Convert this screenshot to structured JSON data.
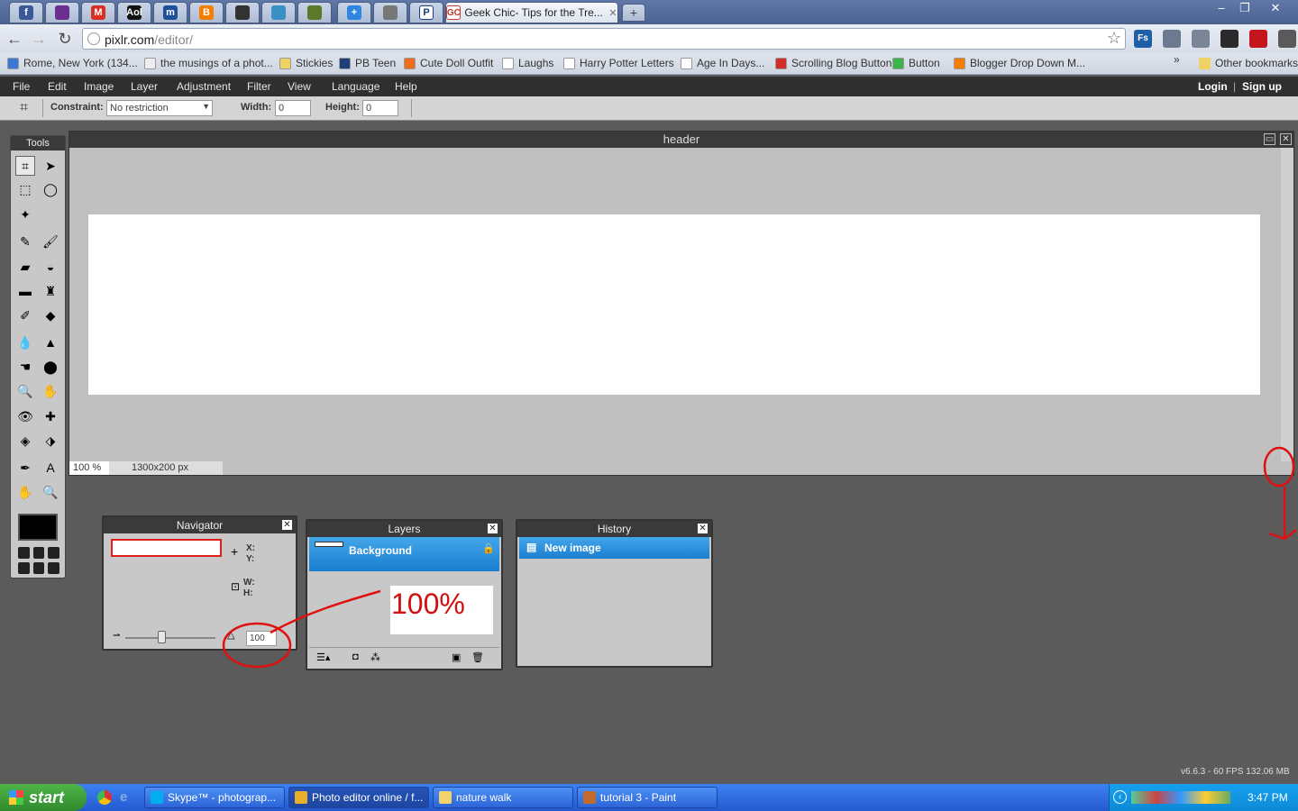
{
  "browser": {
    "tabs": [
      {
        "icon": "facebook-icon",
        "letter": "f",
        "color": "#3b5998"
      },
      {
        "icon": "yahoo-mail-icon",
        "letter": "",
        "color": "#6b2f91"
      },
      {
        "icon": "gmail-icon",
        "letter": "M",
        "color": "#d93025"
      },
      {
        "icon": "aol-icon",
        "letter": "Aol",
        "color": "#111111"
      },
      {
        "icon": "m-icon",
        "letter": "m",
        "color": "#1e4f9a"
      },
      {
        "icon": "blogger-icon",
        "letter": "B",
        "color": "#f57d00"
      },
      {
        "icon": "camera-icon",
        "letter": "",
        "color": "#333333"
      },
      {
        "icon": "photo-icon",
        "letter": "",
        "color": "#3a8fc4"
      },
      {
        "icon": "pixlr-icon",
        "letter": "",
        "color": "#5a7a2a"
      },
      {
        "icon": "plus-icon",
        "letter": "+",
        "color": "#2f86e0"
      },
      {
        "icon": "loading-icon",
        "letter": "",
        "color": "#777777"
      },
      {
        "icon": "p-icon",
        "letter": "P",
        "color": "#ffffff"
      }
    ],
    "active_tab_title": "Geek Chic- Tips for the Tre...",
    "url_host": "pixlr.com",
    "url_path": "/editor/",
    "extensions": [
      {
        "icon": "fs-icon",
        "label": "Fs",
        "color": "#1f5fa8"
      },
      {
        "icon": "camera-ext-icon",
        "label": "",
        "color": "#6b7a90"
      },
      {
        "icon": "bug-icon",
        "label": "",
        "color": "#7a8698"
      },
      {
        "icon": "color-wheel-icon",
        "label": "",
        "color": "#2a2a2a"
      },
      {
        "icon": "power-icon",
        "label": "",
        "color": "#c4151c"
      },
      {
        "icon": "wrench-icon",
        "label": "",
        "color": "#5a5a5a"
      }
    ],
    "bookmarks": [
      {
        "label": "Rome, New York (134...",
        "color": "#3b78d4"
      },
      {
        "label": "the musings of a phot...",
        "color": "#eeeeee"
      },
      {
        "label": "Stickies",
        "color": "#f0d264"
      },
      {
        "label": "PB Teen",
        "color": "#1e3f7a"
      },
      {
        "label": "Cute Doll Outfit",
        "color": "#f26c1e"
      },
      {
        "label": "Laughs",
        "color": "#ffffff"
      },
      {
        "label": "Harry Potter Letters",
        "color": "#ffffff"
      },
      {
        "label": "Age In Days...",
        "color": "#ffffff"
      },
      {
        "label": "Scrolling Blog Buttons",
        "color": "#d42b2b"
      },
      {
        "label": "Button",
        "color": "#3bb44a"
      },
      {
        "label": "Blogger Drop Down M...",
        "color": "#f57d00"
      }
    ],
    "bookmarks_overflow": "»",
    "other_bookmarks": "Other bookmarks"
  },
  "pixlr": {
    "menu": [
      "File",
      "Edit",
      "Image",
      "Layer",
      "Adjustment",
      "Filter",
      "View",
      "Language",
      "Help"
    ],
    "login": "Login",
    "separator": "|",
    "signup": "Sign up",
    "options": {
      "constraint_label": "Constraint:",
      "constraint_value": "No restriction",
      "width_label": "Width:",
      "width_value": "0",
      "height_label": "Height:",
      "height_value": "0"
    },
    "tools_title": "Tools",
    "tools": [
      "crop-icon",
      "move-icon",
      "marquee-icon",
      "lasso-icon",
      "magic-wand-icon",
      "",
      "pencil-icon",
      "brush-icon",
      "eraser-icon",
      "paint-bucket-icon",
      "gradient-icon",
      "clone-stamp-icon",
      "color-replace-icon",
      "drawing-icon",
      "blur-icon",
      "sharpen-icon",
      "smudge-icon",
      "sponge-icon",
      "dodge-icon",
      "burn-icon",
      "red-eye-icon",
      "spot-heal-icon",
      "bloat-icon",
      "pinch-icon",
      "color-picker-icon",
      "type-icon",
      "hand-icon",
      "zoom-icon"
    ],
    "document": {
      "title": "header",
      "zoom": "100 %",
      "size": "1300x200 px"
    },
    "navigator": {
      "title": "Navigator",
      "x_label": "X:",
      "y_label": "Y:",
      "w_label": "W:",
      "h_label": "H:",
      "zoom_value": "100",
      "zoom_level": 0.4
    },
    "layers": {
      "title": "Layers",
      "background": "Background"
    },
    "history": {
      "title": "History",
      "entry": "New image"
    },
    "annotation": "100%",
    "version": "v6.6.3 - 60 FPS 132.06 MB"
  },
  "taskbar": {
    "start": "start",
    "tasks": [
      {
        "label": "Skype™ - photograp...",
        "color": "#00aff0"
      },
      {
        "label": "Photo editor online / f...",
        "color": "#e8b02a"
      },
      {
        "label": "nature walk",
        "color": "#f2d26a"
      },
      {
        "label": "tutorial 3 - Paint",
        "color": "#c46a2a"
      }
    ],
    "clock": "3:47 PM"
  }
}
